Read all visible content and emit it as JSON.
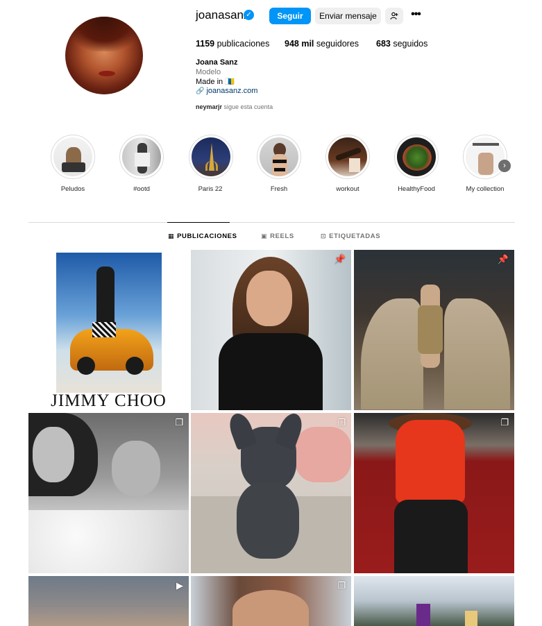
{
  "profile": {
    "username": "joanasanz",
    "verified_mark": "✓",
    "buttons": {
      "follow": "Seguir",
      "message": "Enviar mensaje",
      "add_user": "+ꕤ",
      "more": "•••"
    },
    "stats": {
      "posts_count": "1159",
      "posts_label": "publicaciones",
      "followers_count": "948 mil",
      "followers_label": "seguidores",
      "following_count": "683",
      "following_label": "seguidos"
    },
    "bio": {
      "name": "Joana Sanz",
      "category": "Modelo",
      "text": "Made in 🇮🇨",
      "link_icon": "link-icon",
      "link": "joanasanz.com"
    },
    "followed_by": {
      "user": "neymarjr",
      "text": " sigue esta cuenta"
    }
  },
  "highlights": [
    {
      "label": "Peludos",
      "icon": "dog-photo"
    },
    {
      "label": "#ootd",
      "icon": "outfit-photo"
    },
    {
      "label": "Paris 22",
      "icon": "eiffel-photo"
    },
    {
      "label": "Fresh",
      "icon": "swimwear-photo"
    },
    {
      "label": "workout",
      "icon": "workout-photo"
    },
    {
      "label": "HealthyFood",
      "icon": "food-photo"
    },
    {
      "label": "My collection",
      "icon": "collection-photo"
    }
  ],
  "tabs": [
    {
      "label": "PUBLICACIONES",
      "icon": "grid-icon",
      "active": true
    },
    {
      "label": "REELS",
      "icon": "reels-icon",
      "active": false
    },
    {
      "label": "ETIQUETADAS",
      "icon": "tagged-icon",
      "active": false
    }
  ],
  "posts": [
    {
      "caption": "JIMMY CHOO",
      "badge": ""
    },
    {
      "caption": "",
      "badge": "pin-icon"
    },
    {
      "caption": "",
      "badge": "pin-icon"
    },
    {
      "caption": "",
      "badge": "carousel-icon"
    },
    {
      "caption": "",
      "badge": "carousel-icon"
    },
    {
      "caption": "",
      "badge": "carousel-icon"
    },
    {
      "caption": "",
      "badge": "reel-icon"
    },
    {
      "caption": "",
      "badge": "carousel-icon"
    },
    {
      "caption": "",
      "badge": ""
    }
  ],
  "colors": {
    "accent": "#0095f6",
    "button_gray": "#efefef",
    "muted_text": "#737373",
    "link": "#00376b"
  }
}
